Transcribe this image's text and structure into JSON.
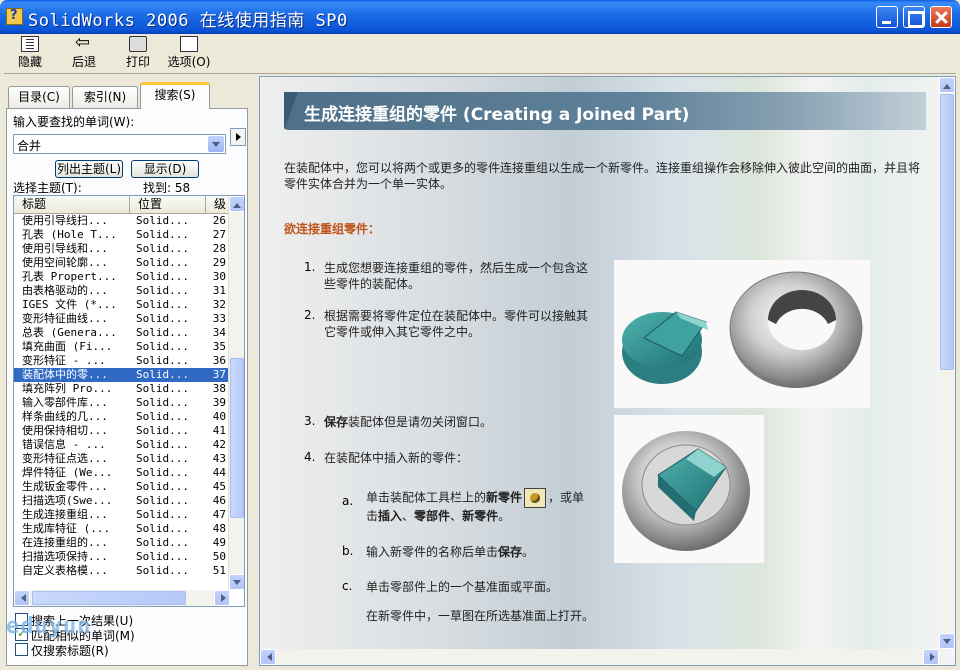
{
  "window": {
    "title": "SolidWorks 2006 在线使用指南 SP0"
  },
  "toolbar": {
    "hide": "隐藏",
    "back": "后退",
    "print": "打印",
    "options": "选项(O)"
  },
  "tabs": [
    {
      "label": "目录(C)"
    },
    {
      "label": "索引(N)"
    },
    {
      "label": "搜索(S)"
    }
  ],
  "search": {
    "prompt": "输入要查找的单词(W):",
    "value": "合并",
    "list_button": "列出主题(L)",
    "display_button": "显示(D)",
    "select_label": "选择主题(T):",
    "found": "找到: 58",
    "columns": [
      "标题",
      "位置",
      "级"
    ]
  },
  "results": [
    {
      "title": "使用引导线扫...",
      "location": "Solid...",
      "rank": "26"
    },
    {
      "title": "孔表 (Hole T...",
      "location": "Solid...",
      "rank": "27"
    },
    {
      "title": "使用引导线和...",
      "location": "Solid...",
      "rank": "28"
    },
    {
      "title": "使用空间轮廓...",
      "location": "Solid...",
      "rank": "29"
    },
    {
      "title": "孔表 Propert...",
      "location": "Solid...",
      "rank": "30"
    },
    {
      "title": "由表格驱动的...",
      "location": "Solid...",
      "rank": "31"
    },
    {
      "title": "IGES 文件 (*...",
      "location": "Solid...",
      "rank": "32"
    },
    {
      "title": "变形特征曲线...",
      "location": "Solid...",
      "rank": "33"
    },
    {
      "title": "总表 (Genera...",
      "location": "Solid...",
      "rank": "34"
    },
    {
      "title": "填充曲面 (Fi...",
      "location": "Solid...",
      "rank": "35"
    },
    {
      "title": "变形特征 - ...",
      "location": "Solid...",
      "rank": "36"
    },
    {
      "title": "装配体中的零...",
      "location": "Solid...",
      "rank": "37"
    },
    {
      "title": "填充阵列 Pro...",
      "location": "Solid...",
      "rank": "38"
    },
    {
      "title": "输入零部件库...",
      "location": "Solid...",
      "rank": "39"
    },
    {
      "title": "样条曲线的几...",
      "location": "Solid...",
      "rank": "40"
    },
    {
      "title": "使用保持相切...",
      "location": "Solid...",
      "rank": "41"
    },
    {
      "title": "错误信息 - ...",
      "location": "Solid...",
      "rank": "42"
    },
    {
      "title": "变形特征点选...",
      "location": "Solid...",
      "rank": "43"
    },
    {
      "title": "焊件特征 (We...",
      "location": "Solid...",
      "rank": "44"
    },
    {
      "title": "生成钣金零件...",
      "location": "Solid...",
      "rank": "45"
    },
    {
      "title": "扫描选项(Swe...",
      "location": "Solid...",
      "rank": "46"
    },
    {
      "title": "生成连接重组...",
      "location": "Solid...",
      "rank": "47"
    },
    {
      "title": "生成库特征 (...",
      "location": "Solid...",
      "rank": "48"
    },
    {
      "title": "在连接重组的...",
      "location": "Solid...",
      "rank": "49"
    },
    {
      "title": "扫描选项保持...",
      "location": "Solid...",
      "rank": "50"
    },
    {
      "title": "自定义表格模...",
      "location": "Solid...",
      "rank": "51"
    }
  ],
  "selected_rank": "37",
  "options": {
    "search_previous": "搜索上一次结果(U)",
    "match_similar": "匹配相似的单词(M)",
    "titles_only": "仅搜索标题(R)"
  },
  "checkbox_states": {
    "search_previous": false,
    "match_similar": true,
    "titles_only": false
  },
  "article": {
    "title": "生成连接重组的零件 (Creating a Joined Part)",
    "intro": "在装配体中，您可以将两个或更多的零件连接重组以生成一个新零件。连接重组操作会移除伸入彼此空间的曲面，并且将零件实体合并为一个单一实体。",
    "procedure_heading": "欲连接重组零件：",
    "steps": [
      {
        "num": "1.",
        "text": "生成您想要连接重组的零件，然后生成一个包含这些零件的装配体。"
      },
      {
        "num": "2.",
        "text": "根据需要将零件定位在装配体中。零件可以接触其它零件或伸入其它零件之中。"
      },
      {
        "num": "3.",
        "bold": "保存",
        "text": "装配体但是请勿关闭窗口。"
      },
      {
        "num": "4.",
        "text": "在装配体中插入新的零件："
      }
    ],
    "substeps": [
      {
        "num": "a.",
        "pre": "单击装配体工具栏上的",
        "bold1": "新零件",
        "mid": "，或单击",
        "bold2": "插入",
        "sep1": "、",
        "bold3": "零部件",
        "sep2": "、",
        "bold4": "新零件",
        "end": "。"
      },
      {
        "num": "b.",
        "pre": "输入新零件的名称后单击",
        "bold1": "保存",
        "end": "。"
      },
      {
        "num": "c.",
        "text": "单击零部件上的一个基准面或平面。"
      }
    ],
    "substep_c_note": "在新零件中，一草图在所选基准面上打开。"
  },
  "watermark": "eduyun"
}
